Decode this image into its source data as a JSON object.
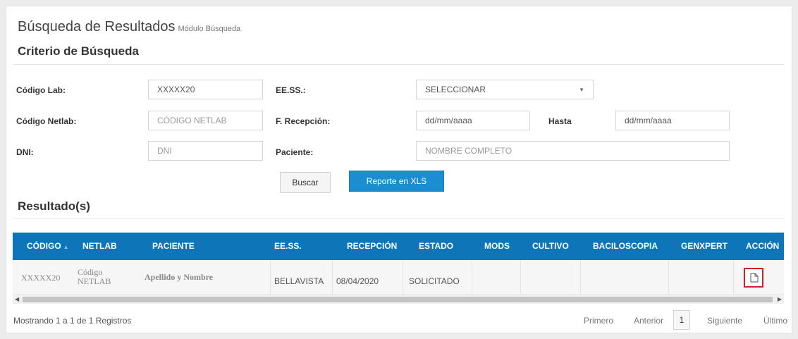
{
  "header": {
    "title": "Búsqueda de Resultados",
    "subtitle": "Módulo Búsqueda"
  },
  "criteria": {
    "heading": "Criterio de Búsqueda",
    "codigo_lab": {
      "label": "Código Lab:",
      "value": "XXXXX20"
    },
    "eess": {
      "label": "EE.SS.:",
      "value": "SELECCIONAR"
    },
    "codigo_netlab": {
      "label": "Código Netlab:",
      "placeholder": "CÓDIGO NETLAB"
    },
    "f_recepcion": {
      "label": "F. Recepción:",
      "placeholder": "dd/mm/aaaa"
    },
    "hasta": {
      "label": "Hasta",
      "placeholder": "dd/mm/aaaa"
    },
    "dni": {
      "label": "DNI:",
      "placeholder": "DNI"
    },
    "paciente": {
      "label": "Paciente:",
      "placeholder": "NOMBRE COMPLETO"
    },
    "buscar_label": "Buscar",
    "reporte_label": "Reporte en XLS"
  },
  "results": {
    "heading": "Resultado(s)",
    "columns": [
      "CÓDIGO",
      "NETLAB",
      "PACIENTE",
      "EE.SS.",
      "RECEPCIÓN",
      "ESTADO",
      "MODS",
      "CULTIVO",
      "BACILOSCOPIA",
      "GENXPERT",
      "ACCIÓN"
    ],
    "rows": [
      {
        "codigo": "XXXXX20",
        "netlab_1": "Código",
        "netlab_2": "NETLAB",
        "paciente": "Apellido y Nombre",
        "eess": "BELLAVISTA",
        "recepcion": "08/04/2020",
        "estado": "SOLICITADO",
        "action_icon": "document-icon"
      }
    ]
  },
  "footer": {
    "info": "Mostrando 1 a 1 de 1 Registros",
    "primero": "Primero",
    "anterior": "Anterior",
    "page": "1",
    "siguiente": "Siguiente",
    "ultimo": "Último"
  },
  "colors": {
    "header_bg": "#0e76b8",
    "primary_button": "#1a8ed0",
    "action_border": "#d32020"
  }
}
